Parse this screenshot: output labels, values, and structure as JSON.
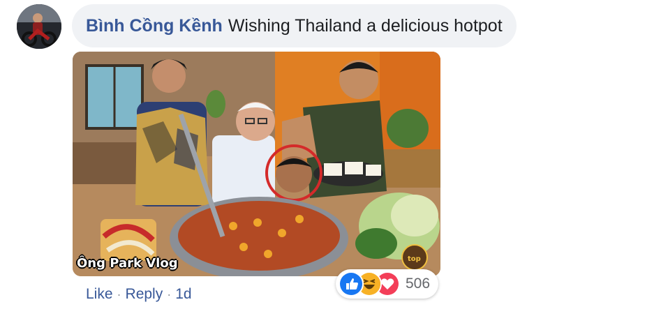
{
  "comment": {
    "author": "Bình Cồng Kềnh",
    "text": "Wishing Thailand a delicious hotpot"
  },
  "photo": {
    "watermark": "Ông Park Vlog",
    "corner_logo": "top"
  },
  "actions": {
    "like_label": "Like",
    "reply_label": "Reply",
    "separator": "·",
    "timestamp": "1d"
  },
  "reactions": {
    "icons": [
      "like-icon",
      "haha-icon",
      "love-icon"
    ],
    "count": "506"
  },
  "colors": {
    "author": "#385898",
    "bubble": "#f0f2f5",
    "like": "#1877f2",
    "haha": "#f7b125",
    "love": "#f33e58",
    "count": "#65676b"
  }
}
